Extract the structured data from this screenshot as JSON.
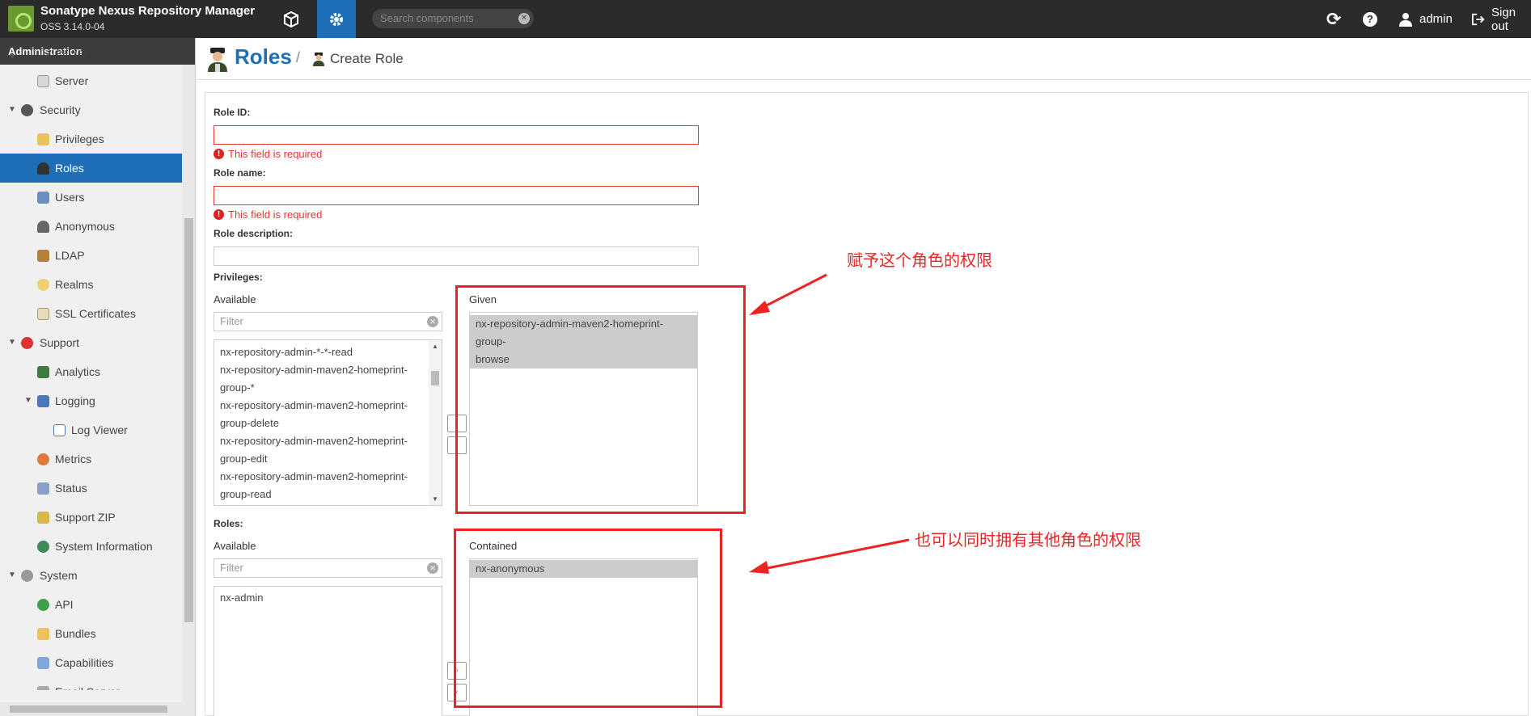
{
  "header": {
    "app_title": "Sonatype Nexus Repository Manager",
    "app_version": "OSS 3.14.0-04",
    "search_placeholder": "Search components",
    "user_label": "admin",
    "signout_label": "Sign out"
  },
  "sidebar": {
    "title": "Administration",
    "partial_top_label": "IQ Server",
    "items": [
      {
        "label": "Server"
      },
      {
        "label": "Security"
      },
      {
        "label": "Privileges"
      },
      {
        "label": "Roles"
      },
      {
        "label": "Users"
      },
      {
        "label": "Anonymous"
      },
      {
        "label": "LDAP"
      },
      {
        "label": "Realms"
      },
      {
        "label": "SSL Certificates"
      },
      {
        "label": "Support"
      },
      {
        "label": "Analytics"
      },
      {
        "label": "Logging"
      },
      {
        "label": "Log Viewer"
      },
      {
        "label": "Metrics"
      },
      {
        "label": "Status"
      },
      {
        "label": "Support ZIP"
      },
      {
        "label": "System Information"
      },
      {
        "label": "System"
      },
      {
        "label": "API"
      },
      {
        "label": "Bundles"
      },
      {
        "label": "Capabilities"
      },
      {
        "label": "Email Server"
      }
    ]
  },
  "breadcrumb": {
    "title": "Roles",
    "separator": "/",
    "current": "Create Role"
  },
  "form": {
    "role_id_label": "Role ID:",
    "role_id_value": "",
    "role_id_error": "This field is required",
    "role_name_label": "Role name:",
    "role_name_value": "",
    "role_name_error": "This field is required",
    "role_desc_label": "Role description:",
    "role_desc_value": "",
    "privileges_label": "Privileges:",
    "priv_available_label": "Available",
    "priv_filter_placeholder": "Filter",
    "priv_available": [
      "nx-repository-admin-*-*-read",
      "nx-repository-admin-maven2-homeprint-",
      "group-*",
      "nx-repository-admin-maven2-homeprint-",
      "group-delete",
      "nx-repository-admin-maven2-homeprint-",
      "group-edit",
      "nx-repository-admin-maven2-homeprint-",
      "group-read"
    ],
    "priv_given_label": "Given",
    "priv_given": [
      "nx-repository-admin-maven2-homeprint-group-",
      "browse"
    ],
    "roles_label": "Roles:",
    "roles_available_label": "Available",
    "roles_filter_placeholder": "Filter",
    "roles_available": [
      "nx-admin"
    ],
    "roles_contained_label": "Contained",
    "roles_contained": [
      "nx-anonymous"
    ]
  },
  "annotations": {
    "privileges_note": "赋予这个角色的权限",
    "roles_note": "也可以同时拥有其他角色的权限"
  },
  "colors": {
    "accent": "#1f6fb7",
    "error": "#ee2222",
    "header_bg": "#2b2b2b"
  }
}
